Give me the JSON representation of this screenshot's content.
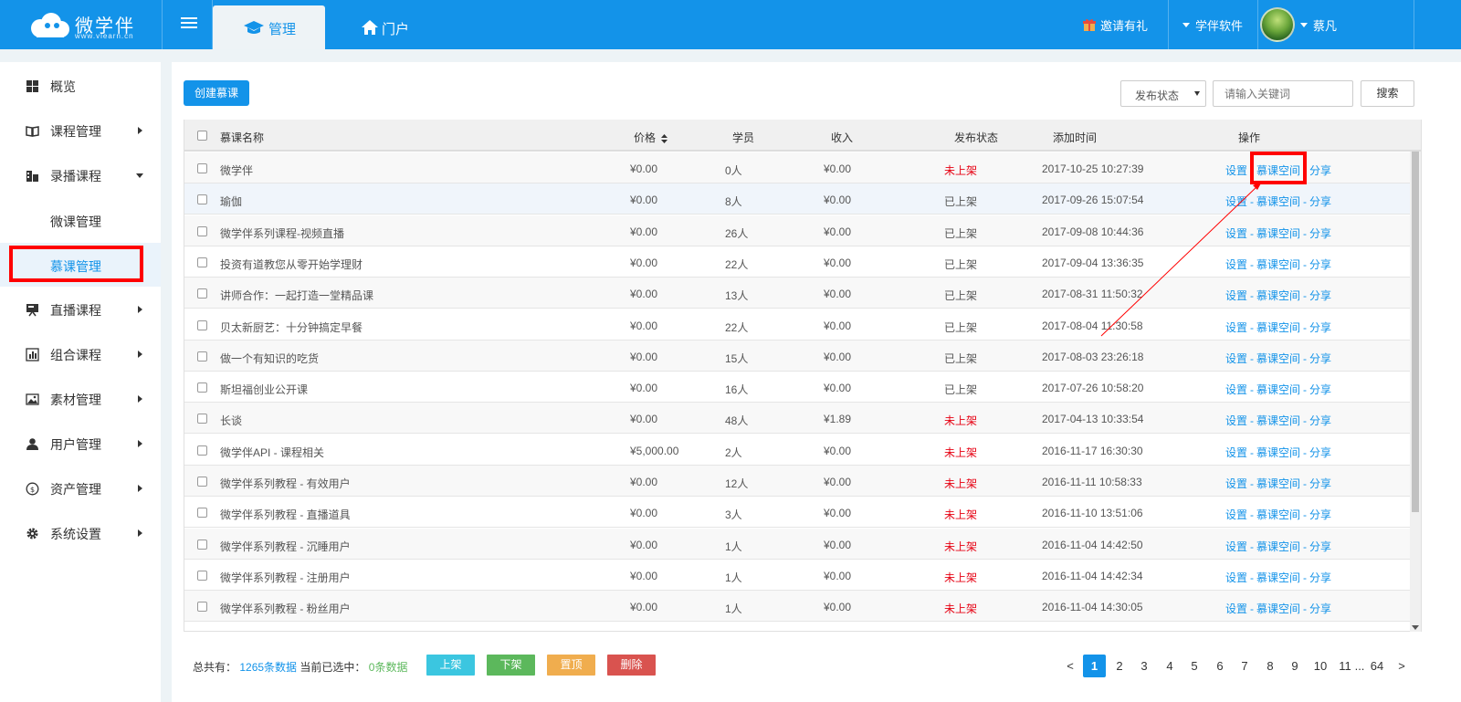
{
  "brand": {
    "name": "微学伴",
    "url": "www.vlearn.cn"
  },
  "nav": {
    "tabs": [
      {
        "label": "管理",
        "icon": "graduation-cap-icon"
      },
      {
        "label": "门户",
        "icon": "home-icon"
      }
    ],
    "invite": "邀请有礼",
    "software": "学伴软件",
    "user": "蔡凡"
  },
  "sidebar": {
    "items": [
      {
        "label": "概览",
        "icon": "grid-icon"
      },
      {
        "label": "课程管理",
        "icon": "book-icon"
      },
      {
        "label": "录播课程",
        "icon": "video-icon"
      },
      {
        "label": "直播课程",
        "icon": "presentation-icon"
      },
      {
        "label": "组合课程",
        "icon": "bar-chart-icon"
      },
      {
        "label": "素材管理",
        "icon": "image-icon"
      },
      {
        "label": "用户管理",
        "icon": "user-icon"
      },
      {
        "label": "资产管理",
        "icon": "coin-icon"
      },
      {
        "label": "系统设置",
        "icon": "gear-icon"
      }
    ],
    "subitems": [
      "微课管理",
      "慕课管理"
    ]
  },
  "toolbar": {
    "create_label": "创建慕课",
    "status_filter": "发布状态",
    "search_placeholder": "请输入关键词",
    "search_label": "搜索"
  },
  "table": {
    "headers": [
      "慕课名称",
      "价格",
      "学员",
      "收入",
      "发布状态",
      "添加时间",
      "操作"
    ],
    "actions": [
      "设置",
      "慕课空间",
      "分享"
    ],
    "rows": [
      {
        "name": "微学伴",
        "price": "¥0.00",
        "students": "0人",
        "income": "¥0.00",
        "status": "未上架",
        "time": "2017-10-25 10:27:39"
      },
      {
        "name": "瑜伽",
        "price": "¥0.00",
        "students": "8人",
        "income": "¥0.00",
        "status": "已上架",
        "time": "2017-09-26 15:07:54"
      },
      {
        "name": "微学伴系列课程-视频直播",
        "price": "¥0.00",
        "students": "26人",
        "income": "¥0.00",
        "status": "已上架",
        "time": "2017-09-08 10:44:36"
      },
      {
        "name": "投资有道教您从零开始学理财",
        "price": "¥0.00",
        "students": "22人",
        "income": "¥0.00",
        "status": "已上架",
        "time": "2017-09-04 13:36:35"
      },
      {
        "name": "讲师合作：一起打造一堂精品课",
        "price": "¥0.00",
        "students": "13人",
        "income": "¥0.00",
        "status": "已上架",
        "time": "2017-08-31 11:50:32"
      },
      {
        "name": "贝太新厨艺：十分钟搞定早餐",
        "price": "¥0.00",
        "students": "22人",
        "income": "¥0.00",
        "status": "已上架",
        "time": "2017-08-04 11:30:58"
      },
      {
        "name": "做一个有知识的吃货",
        "price": "¥0.00",
        "students": "15人",
        "income": "¥0.00",
        "status": "已上架",
        "time": "2017-08-03 23:26:18"
      },
      {
        "name": "斯坦福创业公开课",
        "price": "¥0.00",
        "students": "16人",
        "income": "¥0.00",
        "status": "已上架",
        "time": "2017-07-26 10:58:20"
      },
      {
        "name": "长谈",
        "price": "¥0.00",
        "students": "48人",
        "income": "¥1.89",
        "status": "未上架",
        "time": "2017-04-13 10:33:54"
      },
      {
        "name": "微学伴API - 课程相关",
        "price": "¥5,000.00",
        "students": "2人",
        "income": "¥0.00",
        "status": "未上架",
        "time": "2016-11-17 16:30:30"
      },
      {
        "name": "微学伴系列教程 - 有效用户",
        "price": "¥0.00",
        "students": "12人",
        "income": "¥0.00",
        "status": "未上架",
        "time": "2016-11-11 10:58:33"
      },
      {
        "name": "微学伴系列教程 - 直播道具",
        "price": "¥0.00",
        "students": "3人",
        "income": "¥0.00",
        "status": "未上架",
        "time": "2016-11-10 13:51:06"
      },
      {
        "name": "微学伴系列教程 - 沉睡用户",
        "price": "¥0.00",
        "students": "1人",
        "income": "¥0.00",
        "status": "未上架",
        "time": "2016-11-04 14:42:50"
      },
      {
        "name": "微学伴系列教程 - 注册用户",
        "price": "¥0.00",
        "students": "1人",
        "income": "¥0.00",
        "status": "未上架",
        "time": "2016-11-04 14:42:34"
      },
      {
        "name": "微学伴系列教程 - 粉丝用户",
        "price": "¥0.00",
        "students": "1人",
        "income": "¥0.00",
        "status": "未上架",
        "time": "2016-11-04 14:30:05"
      }
    ]
  },
  "footer": {
    "total_prefix": "总共有：",
    "total_count": "1265条数据",
    "selected_prefix": "当前已选中：",
    "selected_count": "0条数据",
    "buttons": [
      {
        "label": "上架",
        "color": "#3bc6e0"
      },
      {
        "label": "下架",
        "color": "#5cb85c"
      },
      {
        "label": "置顶",
        "color": "#f0ad4e"
      },
      {
        "label": "删除",
        "color": "#d9534f"
      }
    ]
  },
  "pagination": {
    "prev": "<",
    "next": ">",
    "current": "1",
    "pages": [
      "2",
      "3",
      "4",
      "5",
      "6",
      "7",
      "8",
      "9",
      "10",
      "11"
    ],
    "ellipsis": "...",
    "last": "64"
  },
  "colors": {
    "primary": "#1393e9",
    "unpublished": "#e60012",
    "highlight": "#ff0000"
  }
}
